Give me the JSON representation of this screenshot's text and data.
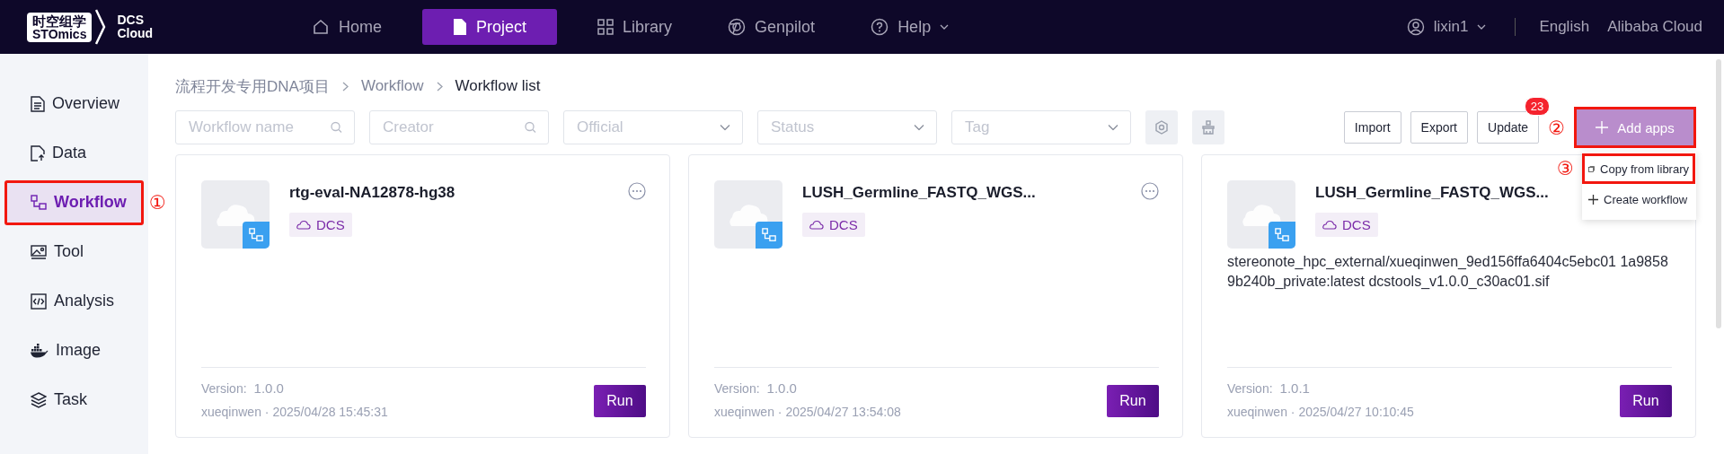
{
  "brand": {
    "logo_cn": "时空组学",
    "logo_en": "STOmics",
    "product_line1": "DCS",
    "product_line2": "Cloud"
  },
  "nav": [
    {
      "label": "Home",
      "selected": false,
      "caret": false
    },
    {
      "label": "Project",
      "selected": true,
      "caret": false
    },
    {
      "label": "Library",
      "selected": false,
      "caret": false
    },
    {
      "label": "Genpilot",
      "selected": false,
      "caret": false
    },
    {
      "label": "Help",
      "selected": false,
      "caret": true
    }
  ],
  "user": {
    "name": "lixin1"
  },
  "links": [
    "English",
    "Alibaba Cloud"
  ],
  "sidebar": [
    {
      "label": "Overview",
      "selected": false,
      "highlighted": false
    },
    {
      "label": "Data",
      "selected": false,
      "highlighted": false
    },
    {
      "label": "Workflow",
      "selected": true,
      "highlighted": true,
      "marker": "①"
    },
    {
      "label": "Tool",
      "selected": false,
      "highlighted": false
    },
    {
      "label": "Analysis",
      "selected": false,
      "highlighted": false
    },
    {
      "label": "Image",
      "selected": false,
      "highlighted": false
    },
    {
      "label": "Task",
      "selected": false,
      "highlighted": false
    }
  ],
  "breadcrumb": [
    "流程开发专用DNA项目",
    "Workflow",
    "Workflow list"
  ],
  "filters": [
    {
      "kind": "search",
      "placeholder": "Workflow name"
    },
    {
      "kind": "search",
      "placeholder": "Creator"
    },
    {
      "kind": "select",
      "placeholder": "Official"
    },
    {
      "kind": "select",
      "placeholder": "Status"
    },
    {
      "kind": "select",
      "placeholder": "Tag"
    }
  ],
  "actions": [
    {
      "label": "Import"
    },
    {
      "label": "Export"
    },
    {
      "label": "Update",
      "badge": "23"
    }
  ],
  "add_button": {
    "label": "Add apps",
    "highlighted": true,
    "marker": "②"
  },
  "add_menu": [
    {
      "label": "Copy from library",
      "highlighted": true,
      "marker": "③"
    },
    {
      "label": "Create workflow",
      "highlighted": false
    }
  ],
  "cards": [
    {
      "title": "rtg-eval-NA12878-hg38",
      "tag": "DCS",
      "more_button": true,
      "version_label": "Version:",
      "version": "1.0.0",
      "meta": "xueqinwen · 2025/04/28 15:45:31",
      "run_label": "Run"
    },
    {
      "title": "LUSH_Germline_FASTQ_WGS...",
      "tag": "DCS",
      "more_button": true,
      "version_label": "Version:",
      "version": "1.0.0",
      "meta": "xueqinwen · 2025/04/27 13:54:08",
      "run_label": "Run"
    },
    {
      "title": "LUSH_Germline_FASTQ_WGS...",
      "tag": "DCS",
      "description": "stereonote_hpc_external/xueqinwen_9ed156ffa6404c5ebc01 1a98589b240b_private:latest dcstools_v1.0.0_c30ac01.sif",
      "version_label": "Version:",
      "version": "1.0.1",
      "meta": "xueqinwen · 2025/04/27 10:10:45",
      "run_label": "Run"
    }
  ]
}
